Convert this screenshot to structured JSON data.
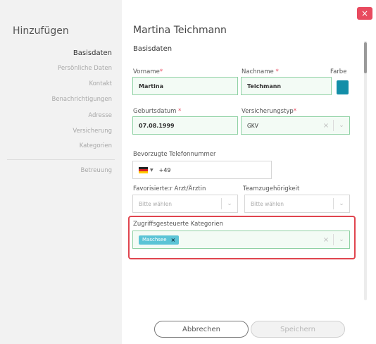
{
  "sidebar": {
    "title": "Hinzufügen",
    "items": [
      {
        "label": "Basisdaten"
      },
      {
        "label": "Persönliche Daten"
      },
      {
        "label": "Kontakt"
      },
      {
        "label": "Benachrichtigungen"
      },
      {
        "label": "Adresse"
      },
      {
        "label": "Versicherung"
      },
      {
        "label": "Kategorien"
      },
      {
        "label": "Betreuung"
      }
    ]
  },
  "header": {
    "person_name": "Martina Teichmann",
    "close_label": "×"
  },
  "section": {
    "title": "Basisdaten"
  },
  "form": {
    "vorname": {
      "label": "Vorname",
      "value": "Martina"
    },
    "nachname": {
      "label": "Nachname",
      "value": "Teichmann"
    },
    "farbe": {
      "label": "Farbe",
      "color": "#138ea8"
    },
    "geburtsdatum": {
      "label": "Geburtsdatum",
      "value": "07.08.1999"
    },
    "versicherungstyp": {
      "label": "Versicherungstyp",
      "value": "GKV"
    },
    "telefon": {
      "label": "Bevorzugte Telefonnummer",
      "value": "+49"
    },
    "arzt": {
      "label": "Favorisierte:r Arzt/Ärztin",
      "placeholder": "Bitte wählen"
    },
    "team": {
      "label": "Teamzugehörigkeit",
      "placeholder": "Bitte wählen"
    },
    "kategorien": {
      "label": "Zugriffsgesteuerte Kategorien",
      "tag": "Maschsee"
    }
  },
  "icons": {
    "required_mark": "*",
    "clear": "×",
    "chevron_down": "⌄",
    "caret_down": "▼"
  },
  "buttons": {
    "cancel": "Abbrechen",
    "save": "Speichern"
  }
}
